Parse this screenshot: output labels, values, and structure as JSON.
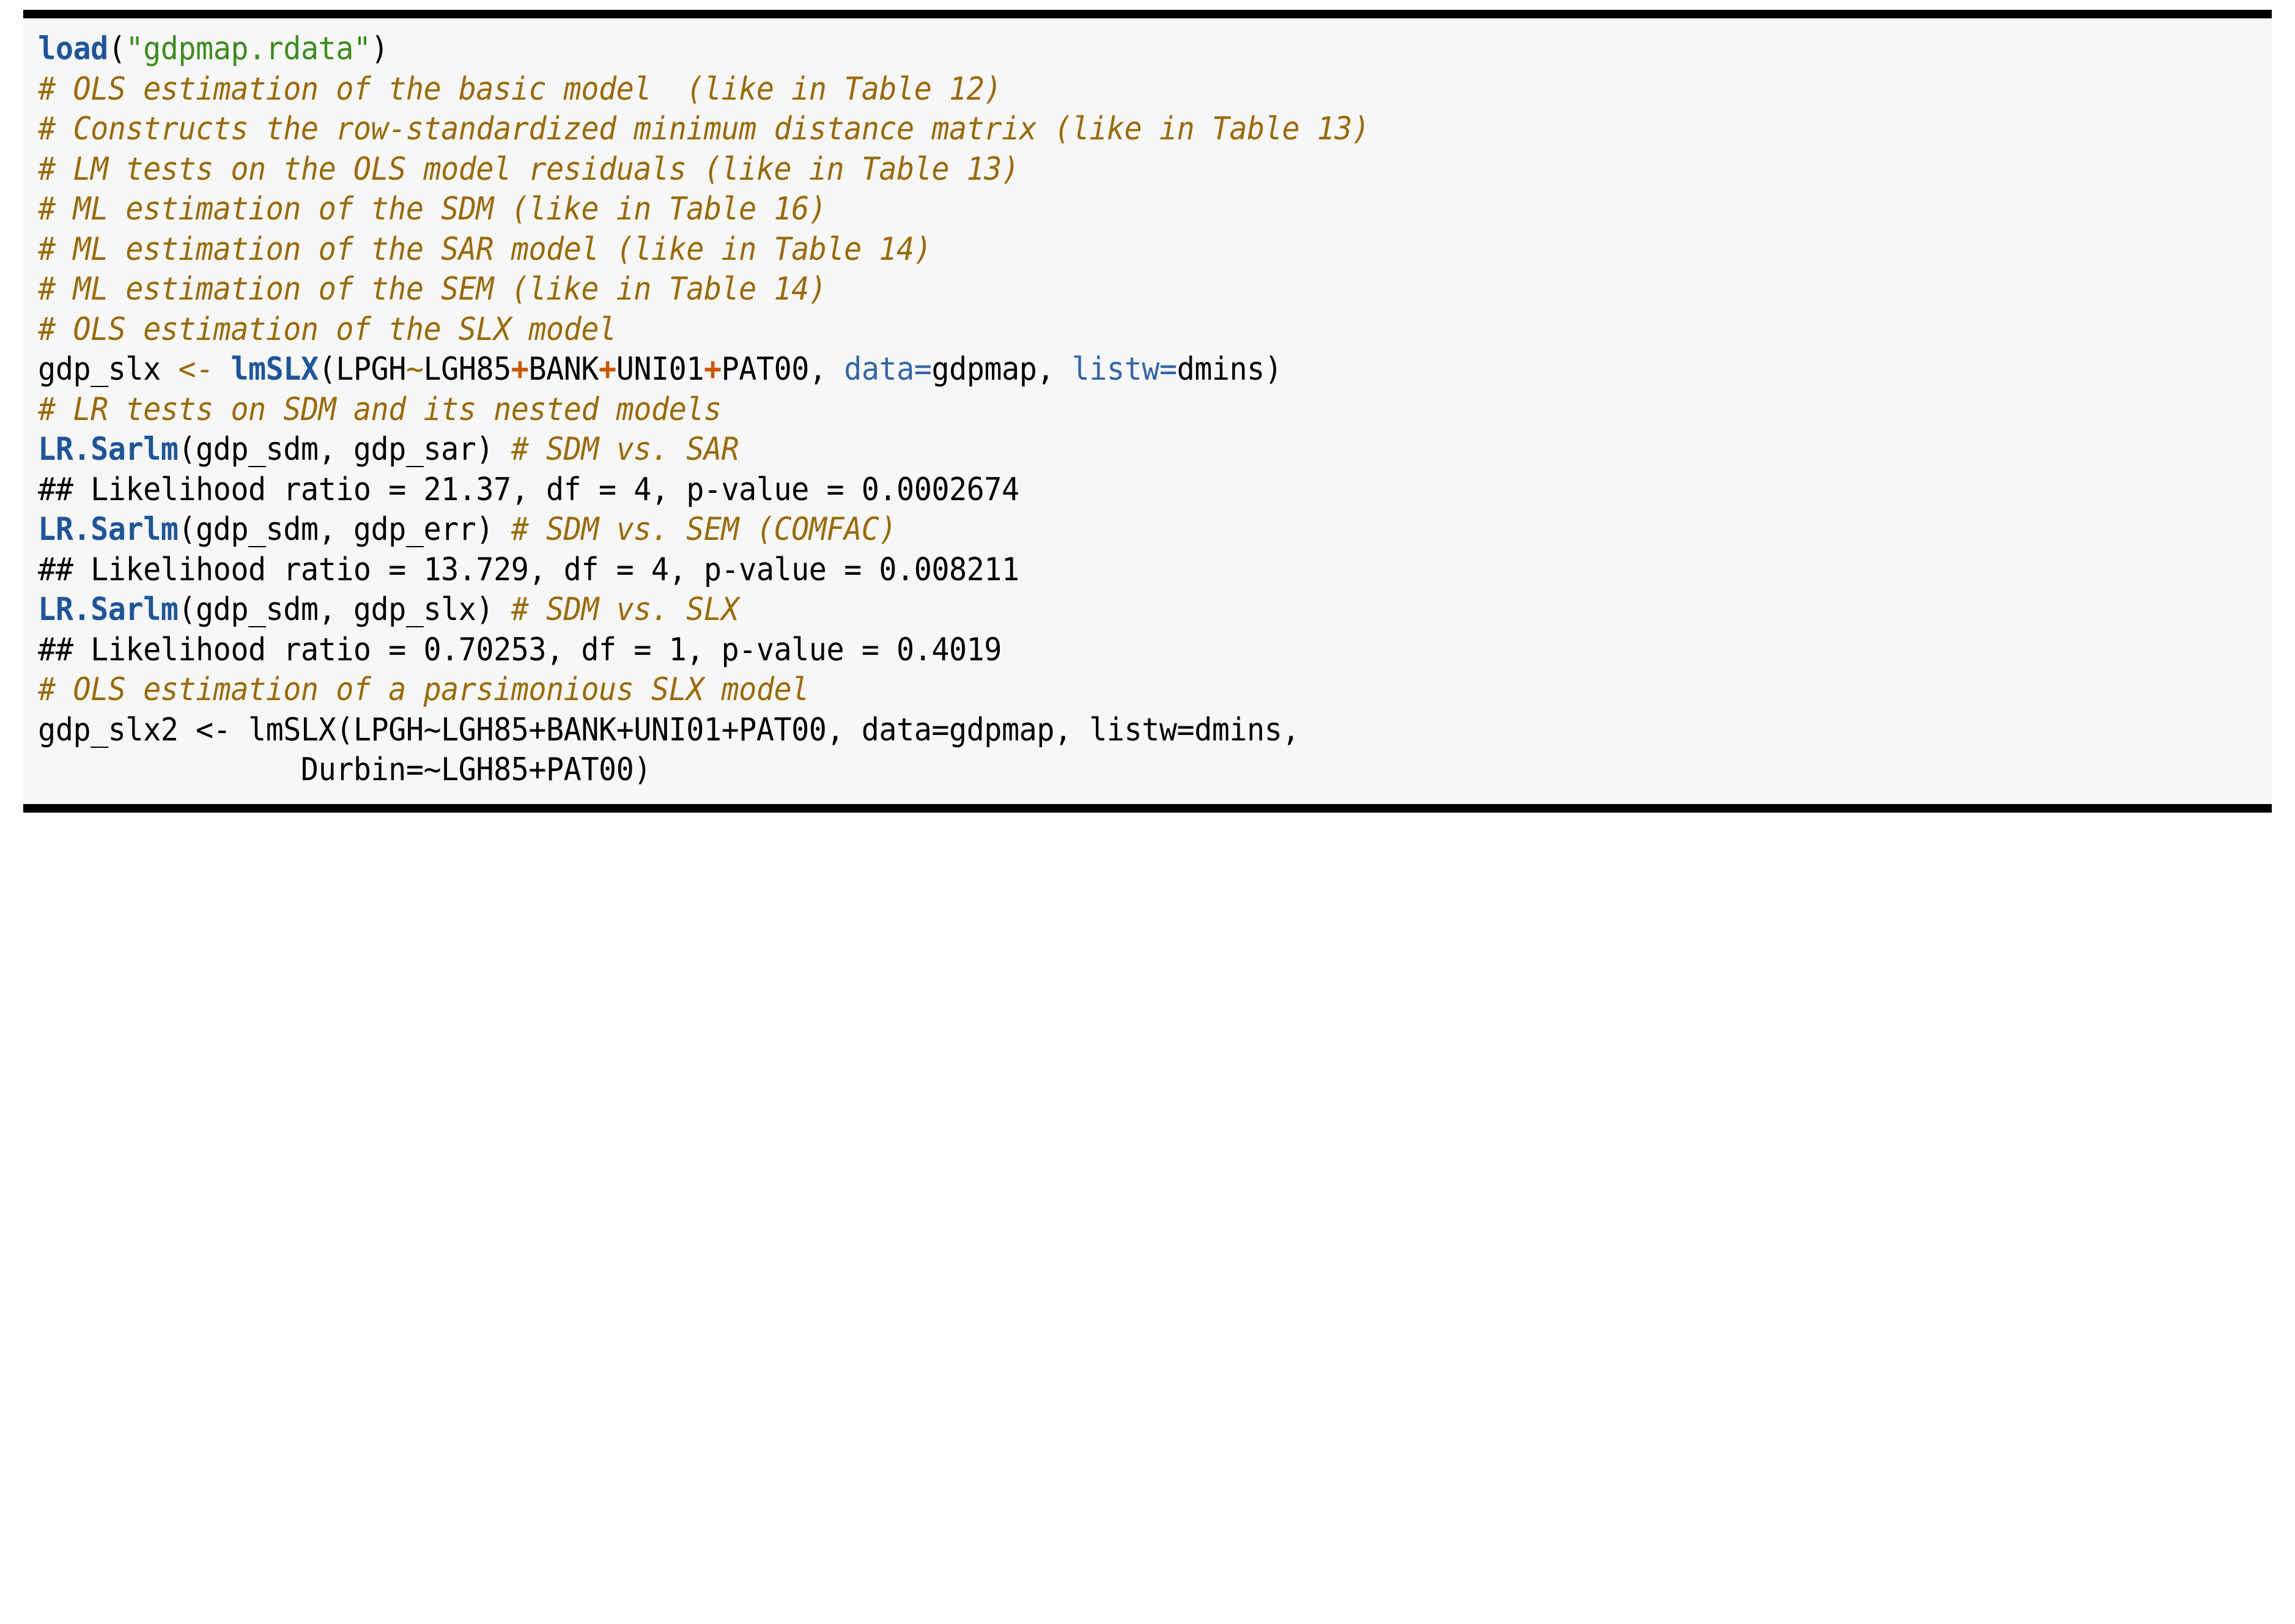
{
  "block": {
    "kind": "r-code-listing",
    "background_color": "#f7f7f7",
    "page_background": "#ffffff",
    "border_color": "#000000",
    "colors": {
      "function": "#1f5599",
      "string": "#3d8b1f",
      "comment": "#9a6a0a",
      "named_argument": "#3366aa",
      "plus_operator": "#cc5500",
      "assign_operator": "#9a6a0a",
      "plain": "#000000"
    }
  },
  "lines": [
    {
      "id": "line-01",
      "kind": "code",
      "text": "load(\"gdpmap.rdata\")",
      "tokens": [
        {
          "t": "load",
          "c": "fn"
        },
        {
          "t": "(",
          "c": "plain"
        },
        {
          "t": "\"gdpmap.rdata\"",
          "c": "str"
        },
        {
          "t": ")",
          "c": "plain"
        }
      ]
    },
    {
      "id": "line-02",
      "kind": "comment",
      "text": "# OLS estimation of the basic model  (like in Table 12)",
      "tokens": [
        {
          "t": "# OLS estimation of the basic model  (like in Table 12)",
          "c": "comment"
        }
      ]
    },
    {
      "id": "line-03",
      "kind": "comment",
      "text": "# Constructs the row-standardized minimum distance matrix (like in Table 13)",
      "tokens": [
        {
          "t": "# Constructs the row-standardized minimum distance matrix (like in Table 13)",
          "c": "comment"
        }
      ]
    },
    {
      "id": "line-04",
      "kind": "comment",
      "text": "# LM tests on the OLS model residuals (like in Table 13)",
      "tokens": [
        {
          "t": "# LM tests on the OLS model residuals (like in Table 13)",
          "c": "comment"
        }
      ]
    },
    {
      "id": "line-05",
      "kind": "comment",
      "text": "# ML estimation of the SDM (like in Table 16)",
      "tokens": [
        {
          "t": "# ML estimation of the SDM (like in Table 16)",
          "c": "comment"
        }
      ]
    },
    {
      "id": "line-06",
      "kind": "comment",
      "text": "# ML estimation of the SAR model (like in Table 14)",
      "tokens": [
        {
          "t": "# ML estimation of the SAR model (like in Table 14)",
          "c": "comment"
        }
      ]
    },
    {
      "id": "line-07",
      "kind": "comment",
      "text": "# ML estimation of the SEM (like in Table 14)",
      "tokens": [
        {
          "t": "# ML estimation of the SEM (like in Table 14)",
          "c": "comment"
        }
      ]
    },
    {
      "id": "line-08",
      "kind": "comment",
      "text": "# OLS estimation of the SLX model",
      "tokens": [
        {
          "t": "# OLS estimation of the SLX model",
          "c": "comment"
        }
      ]
    },
    {
      "id": "line-09",
      "kind": "code",
      "text": "gdp_slx <- lmSLX(LPGH~LGH85+BANK+UNI01+PAT00, data=gdpmap, listw=dmins)",
      "tokens": [
        {
          "t": "gdp_slx ",
          "c": "plain"
        },
        {
          "t": "<-",
          "c": "op"
        },
        {
          "t": " ",
          "c": "plain"
        },
        {
          "t": "lmSLX",
          "c": "fn"
        },
        {
          "t": "(LPGH",
          "c": "plain"
        },
        {
          "t": "~",
          "c": "op"
        },
        {
          "t": "LGH85",
          "c": "plain"
        },
        {
          "t": "+",
          "c": "plus"
        },
        {
          "t": "BANK",
          "c": "plain"
        },
        {
          "t": "+",
          "c": "plus"
        },
        {
          "t": "UNI01",
          "c": "plain"
        },
        {
          "t": "+",
          "c": "plus"
        },
        {
          "t": "PAT00, ",
          "c": "plain"
        },
        {
          "t": "data=",
          "c": "arg"
        },
        {
          "t": "gdpmap, ",
          "c": "plain"
        },
        {
          "t": "listw=",
          "c": "arg"
        },
        {
          "t": "dmins)",
          "c": "plain"
        }
      ]
    },
    {
      "id": "line-10",
      "kind": "comment",
      "text": "# LR tests on SDM and its nested models",
      "tokens": [
        {
          "t": "# LR tests on SDM and its nested models",
          "c": "comment"
        }
      ]
    },
    {
      "id": "line-11",
      "kind": "code",
      "text": "LR.Sarlm(gdp_sdm, gdp_sar) # SDM vs. SAR",
      "tokens": [
        {
          "t": "LR.Sarlm",
          "c": "fn"
        },
        {
          "t": "(gdp_sdm, gdp_sar) ",
          "c": "plain"
        },
        {
          "t": "# SDM vs. SAR",
          "c": "comment"
        }
      ]
    },
    {
      "id": "line-12",
      "kind": "output",
      "text": "## Likelihood ratio = 21.37, df = 4, p-value = 0.0002674",
      "tokens": [
        {
          "t": "## Likelihood ratio = 21.37, df = 4, p-value = 0.0002674",
          "c": "plain"
        }
      ]
    },
    {
      "id": "line-13",
      "kind": "code",
      "text": "LR.Sarlm(gdp_sdm, gdp_err) # SDM vs. SEM (COMFAC)",
      "tokens": [
        {
          "t": "LR.Sarlm",
          "c": "fn"
        },
        {
          "t": "(gdp_sdm, gdp_err) ",
          "c": "plain"
        },
        {
          "t": "# SDM vs. SEM (COMFAC)",
          "c": "comment"
        }
      ]
    },
    {
      "id": "line-14",
      "kind": "output",
      "text": "## Likelihood ratio = 13.729, df = 4, p-value = 0.008211",
      "tokens": [
        {
          "t": "## Likelihood ratio = 13.729, df = 4, p-value = 0.008211",
          "c": "plain"
        }
      ]
    },
    {
      "id": "line-15",
      "kind": "code",
      "text": "LR.Sarlm(gdp_sdm, gdp_slx) # SDM vs. SLX",
      "tokens": [
        {
          "t": "LR.Sarlm",
          "c": "fn"
        },
        {
          "t": "(gdp_sdm, gdp_slx) ",
          "c": "plain"
        },
        {
          "t": "# SDM vs. SLX",
          "c": "comment"
        }
      ]
    },
    {
      "id": "line-16",
      "kind": "output",
      "text": "## Likelihood ratio = 0.70253, df = 1, p-value = 0.4019",
      "tokens": [
        {
          "t": "## Likelihood ratio = 0.70253, df = 1, p-value = 0.4019",
          "c": "plain"
        }
      ]
    },
    {
      "id": "line-17",
      "kind": "comment",
      "text": "# OLS estimation of a parsimonious SLX model",
      "tokens": [
        {
          "t": "# OLS estimation of a parsimonious SLX model",
          "c": "comment"
        }
      ]
    },
    {
      "id": "line-18",
      "kind": "code",
      "text": "gdp_slx2 <- lmSLX(LPGH~LGH85+BANK+UNI01+PAT00, data=gdpmap, listw=dmins,",
      "tokens": [
        {
          "t": "gdp_slx2 <- lmSLX(LPGH~LGH85+BANK+UNI01+PAT00, data=gdpmap, listw=dmins,",
          "c": "plain"
        }
      ]
    },
    {
      "id": "line-19",
      "kind": "code",
      "text": "               Durbin=~LGH85+PAT00)",
      "tokens": [
        {
          "t": "               Durbin=~LGH85+PAT00)",
          "c": "plain"
        }
      ]
    }
  ]
}
